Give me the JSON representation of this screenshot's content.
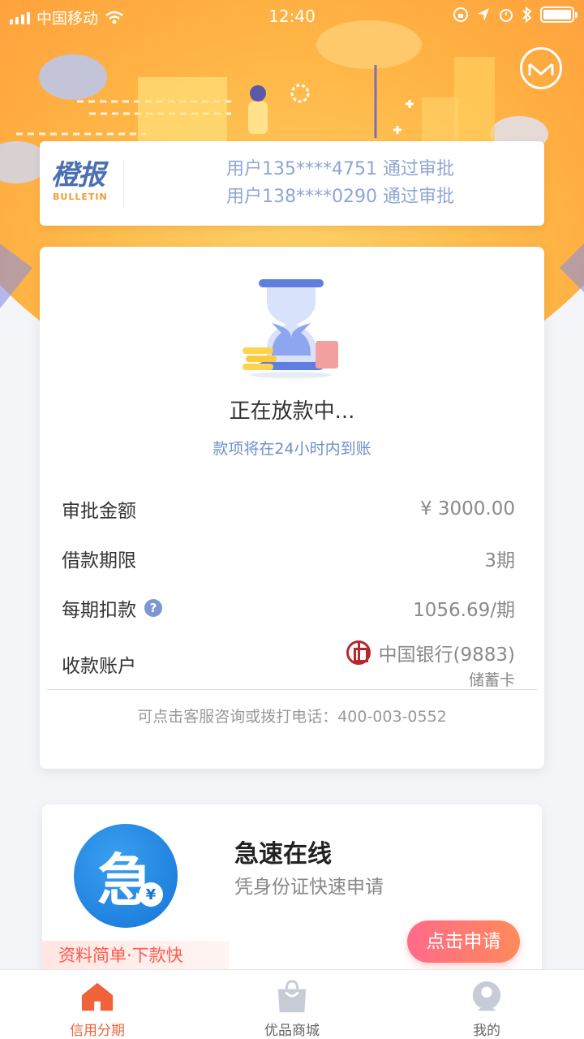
{
  "status_bar": {
    "carrier": "中国移动",
    "time": "12:40"
  },
  "bulletin": {
    "logo_text": "橙报",
    "logo_sub": "BULLETIN",
    "items": [
      "用户135****4751 通过审批",
      "用户138****0290 通过审批"
    ]
  },
  "loan_status": {
    "title": "正在放款中...",
    "subtitle": "款项将在24小时内到账",
    "rows": [
      {
        "label": "审批金额",
        "value": "¥ 3000.00"
      },
      {
        "label": "借款期限",
        "value": "3期"
      },
      {
        "label": "每期扣款",
        "value": "1056.69/期"
      }
    ],
    "account": {
      "label": "收款账户",
      "bank": "中国银行(9883)",
      "card_type": "储蓄卡"
    },
    "contact": "可点击客服咨询或拨打电话：400-003-0552"
  },
  "promo": {
    "icon_char": "急",
    "icon_badge": "¥",
    "name": "急速在线",
    "desc": "凭身份证快速申请",
    "tag": "资料简单·下款快",
    "button": "点击申请"
  },
  "tabs": [
    {
      "label": "信用分期",
      "active": true
    },
    {
      "label": "优品商城",
      "active": false
    },
    {
      "label": "我的",
      "active": false
    }
  ],
  "colors": {
    "accent": "#f0623a",
    "hero": "#ffb545",
    "link_blue": "#6f8fc9"
  }
}
